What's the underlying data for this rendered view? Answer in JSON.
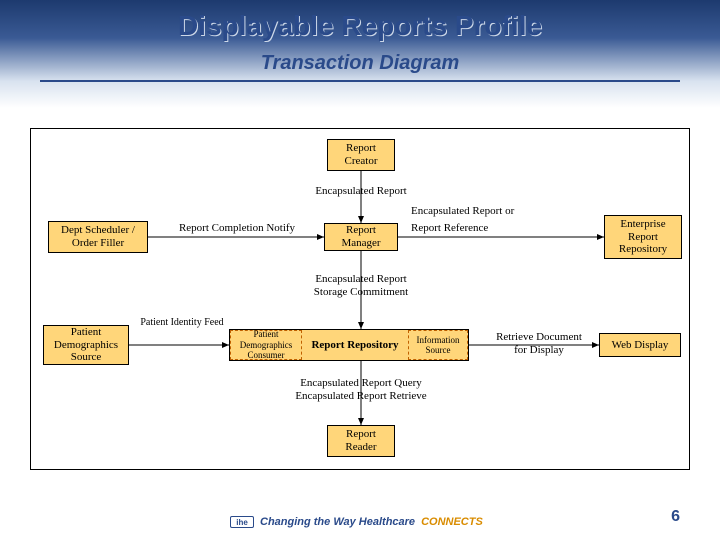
{
  "header": {
    "title": "Displayable Reports Profile",
    "subtitle": "Transaction Diagram"
  },
  "nodes": {
    "report_creator": "Report\nCreator",
    "dept_scheduler": "Dept Scheduler /\nOrder Filler",
    "report_manager": "Report\nManager",
    "enterprise_repo": "Enterprise\nReport\nRepository",
    "patient_demo_source": "Patient\nDemographics\nSource",
    "patient_demo_consumer": "Patient\nDemographics\nConsumer",
    "report_repository": "Report Repository",
    "information_source": "Information\nSource",
    "web_display": "Web Display",
    "report_reader": "Report\nReader"
  },
  "labels": {
    "encapsulated_report": "Encapsulated Report",
    "encapsulated_report_or": "Encapsulated Report or",
    "report_completion_notify": "Report Completion Notify",
    "report_reference": "Report Reference",
    "storage_commitment": "Encapsulated Report\nStorage Commitment",
    "patient_identity_feed": "Patient Identity Feed",
    "retrieve_for_display": "Retrieve Document\nfor Display",
    "query_retrieve": "Encapsulated Report Query\nEncapsulated Report Retrieve"
  },
  "footer": {
    "logo_text": "ihe",
    "tagline_a": "Changing the Way Healthcare",
    "tagline_b": "CONNECTS",
    "page_number": "6"
  }
}
